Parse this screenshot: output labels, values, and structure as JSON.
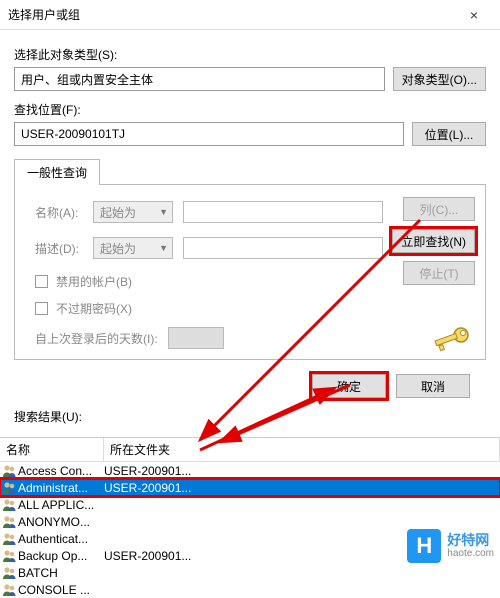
{
  "window": {
    "title": "选择用户或组",
    "close": "×"
  },
  "object_type": {
    "label": "选择此对象类型(S):",
    "value": "用户、组或内置安全主体",
    "button": "对象类型(O)..."
  },
  "location": {
    "label": "查找位置(F):",
    "value": "USER-20090101TJ",
    "button": "位置(L)..."
  },
  "tab": {
    "label": "一般性查询"
  },
  "query": {
    "name_label": "名称(A):",
    "desc_label": "描述(D):",
    "starts_with": "起始为",
    "chk_disabled": "禁用的帐户(B)",
    "chk_noexpire": "不过期密码(X)",
    "days_label": "自上次登录后的天数(I):"
  },
  "sidebuttons": {
    "columns": "列(C)...",
    "findnow": "立即查找(N)",
    "stop": "停止(T)"
  },
  "actions": {
    "ok": "确定",
    "cancel": "取消"
  },
  "results": {
    "label": "搜索结果(U):",
    "col_name": "名称",
    "col_folder": "所在文件夹",
    "rows": [
      {
        "name": "Access Con...",
        "folder": "USER-200901..."
      },
      {
        "name": "Administrat...",
        "folder": "USER-200901..."
      },
      {
        "name": "ALL APPLIC...",
        "folder": ""
      },
      {
        "name": "ANONYMO...",
        "folder": ""
      },
      {
        "name": "Authenticat...",
        "folder": ""
      },
      {
        "name": "Backup Op...",
        "folder": "USER-200901..."
      },
      {
        "name": "BATCH",
        "folder": ""
      },
      {
        "name": "CONSOLE ...",
        "folder": ""
      }
    ],
    "selected_index": 1
  },
  "watermark": {
    "logo": "H",
    "line1": "好特网",
    "line2": "haote.com"
  }
}
